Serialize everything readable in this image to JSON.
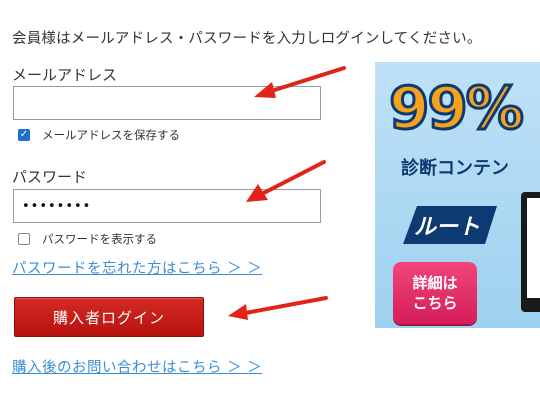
{
  "intro": "会員様はメールアドレス・パスワードを入力しログインしてください。",
  "email": {
    "label": "メールアドレス",
    "value": "",
    "save_label": "メールアドレスを保存する",
    "save_checked": true
  },
  "password": {
    "label": "パスワード",
    "value": "••••••••",
    "show_label": "パスワードを表示する",
    "show_checked": false
  },
  "forgot_link": "パスワードを忘れた方はこちら ＞ ＞",
  "login_button": "購入者ログイン",
  "contact_link": "購入後のお問い合わせはこちら ＞ ＞",
  "banner": {
    "headline": "99%",
    "subtitle": "診断コンテン",
    "logo_text": "ルート",
    "detail_line1": "詳細は",
    "detail_line2": "こちら"
  },
  "colors": {
    "accent_red": "#c41a16",
    "link_blue": "#3a8ed6",
    "arrow_red": "#e2231a",
    "banner_bg": "#bfe1f6",
    "banner_navy": "#0e3a73",
    "banner_orange": "#f7a21b",
    "detail_pink": "#e83370"
  },
  "icons": {
    "annotation_arrow": "red-arrow-icon",
    "checkbox": "checkbox-icon"
  }
}
